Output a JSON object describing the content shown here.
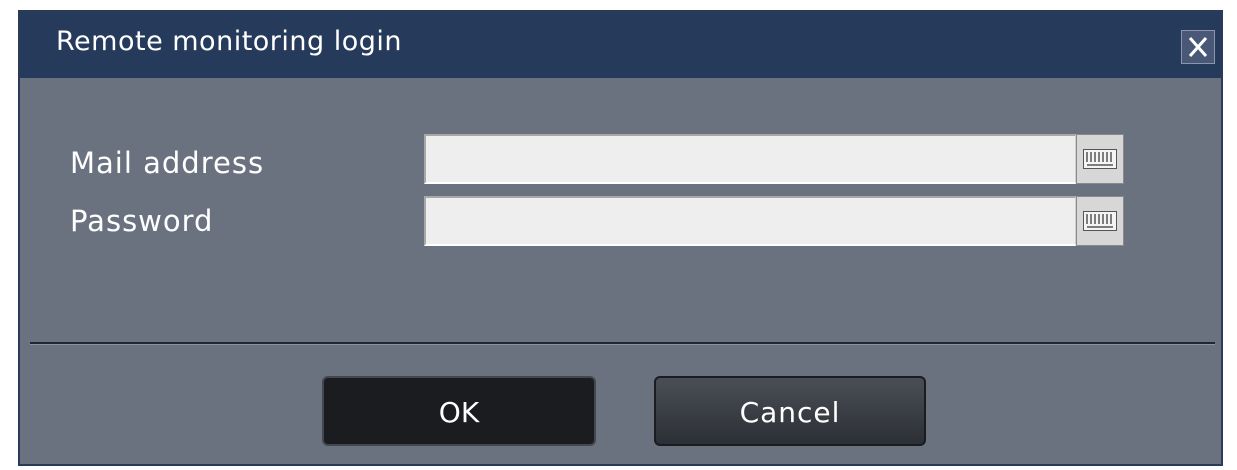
{
  "dialog": {
    "title": "Remote monitoring login",
    "close_icon": "close-icon"
  },
  "form": {
    "mail_label": "Mail address",
    "mail_value": "",
    "password_label": "Password",
    "password_value": "",
    "keyboard_icon": "keyboard-icon"
  },
  "buttons": {
    "ok_label": "OK",
    "cancel_label": "Cancel"
  },
  "colors": {
    "titlebar": "#263a5c",
    "panel": "#6a7280",
    "input": "#eeeeee"
  }
}
